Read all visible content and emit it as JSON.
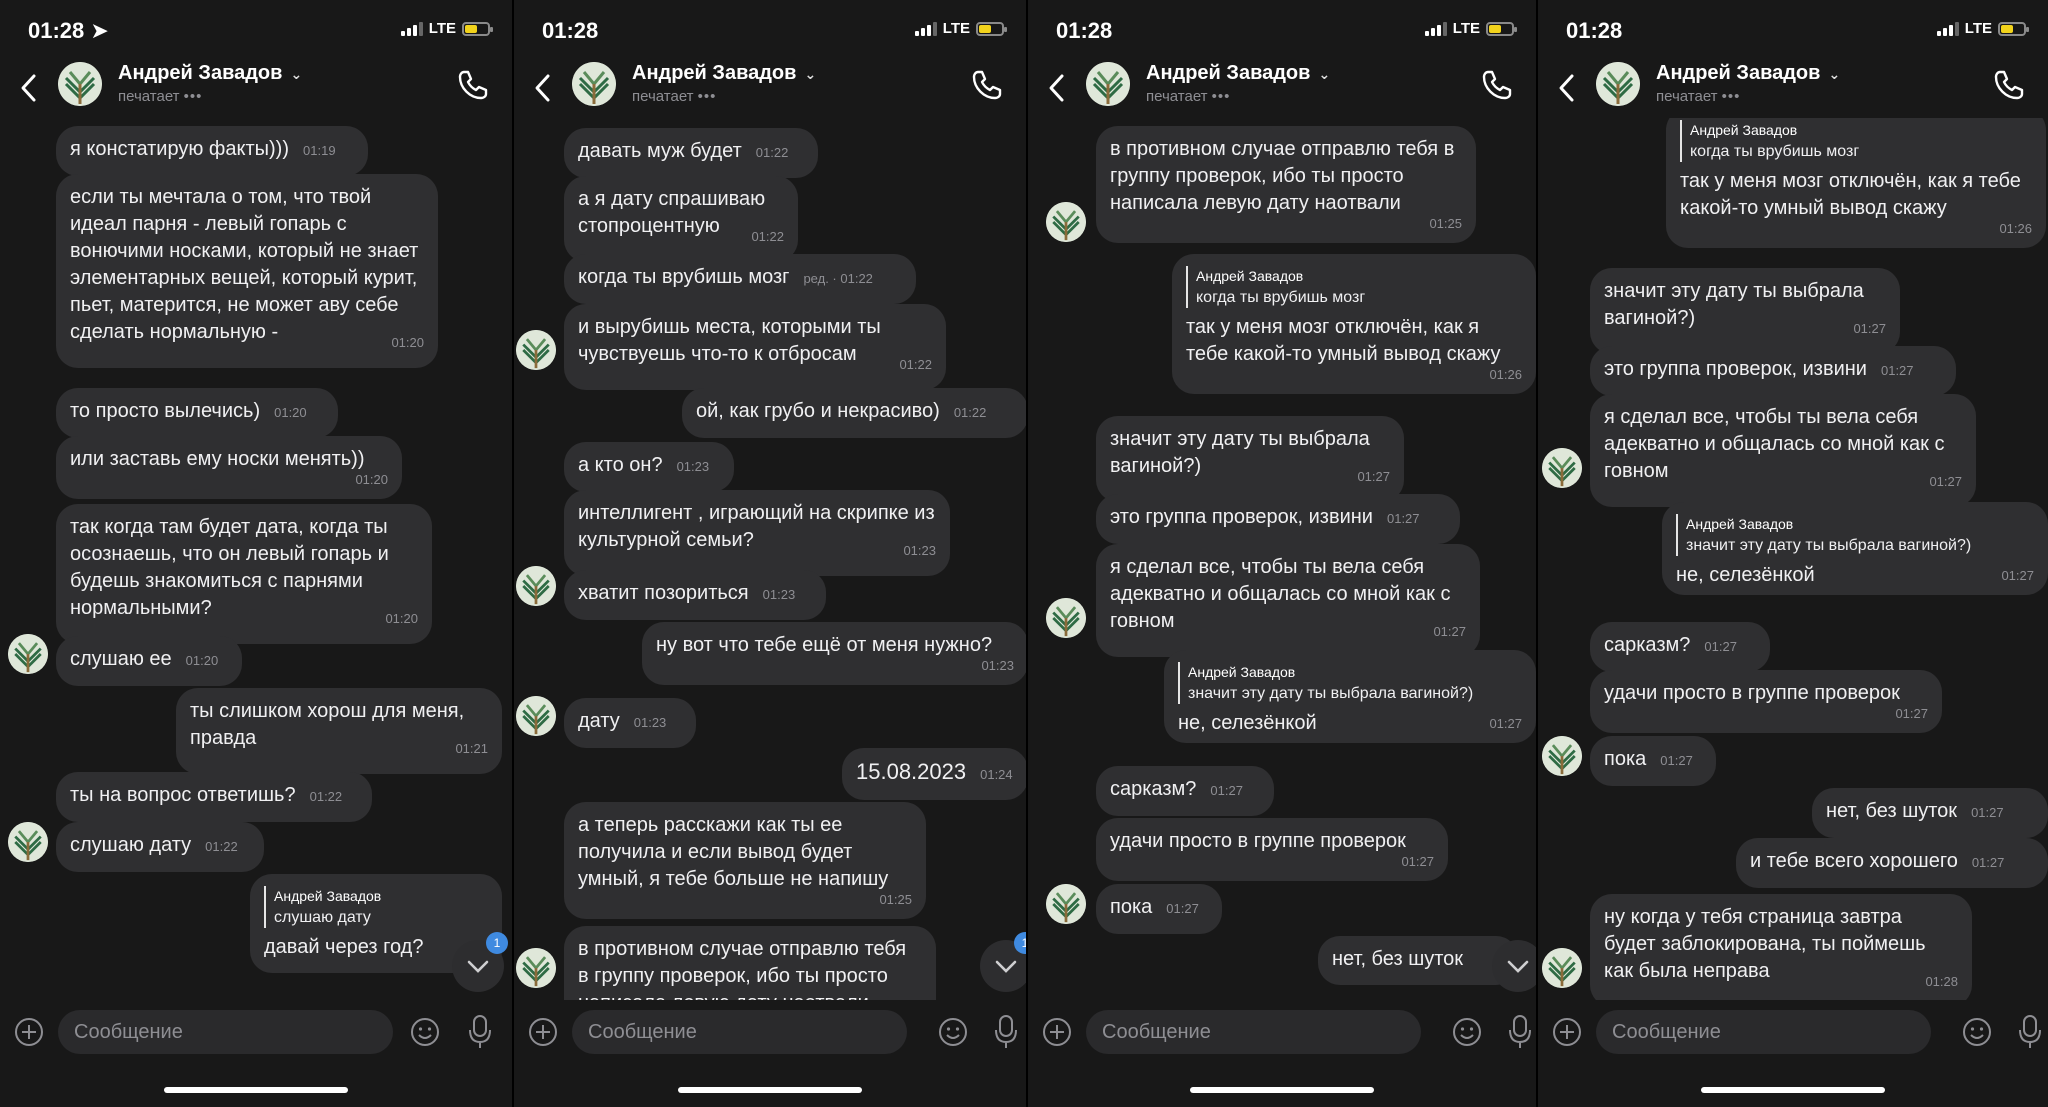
{
  "panels": [
    {
      "time": "01:28 ➤",
      "contact": "Андрей Завадов",
      "status": "печатает",
      "placeholder": "Сообщение",
      "messages": [
        {
          "text": "я констатирую факты)))",
          "time": "01:19"
        },
        {
          "text": "если ты мечтала о том, что твой идеал парня - левый гопарь с вонючими носками, который не знает элементарных вещей, который курит, пьет, матерится, не может аву себе сделать нормальную -",
          "time": "01:20"
        },
        {
          "text": "то просто вылечись)",
          "time": "01:20"
        },
        {
          "text": "или заставь ему носки менять))",
          "time": "01:20"
        },
        {
          "text": "так когда там будет дата, когда ты осознаешь, что он левый гопарь и будешь знакомиться с парнями нормальными?",
          "time": "01:20"
        },
        {
          "text": "слушаю ее",
          "time": "01:20"
        },
        {
          "text": "ты слишком хорош для меня, правда",
          "time": "01:21"
        },
        {
          "text": "ты на вопрос ответишь?",
          "time": "01:22"
        },
        {
          "text": "слушаю дату",
          "time": "01:22"
        },
        {
          "reply_name": "Андрей Завадов",
          "reply_text": "слушаю дату",
          "text": "давай через год?",
          "time": ""
        }
      ],
      "unread": "1"
    },
    {
      "time": "01:28",
      "contact": "Андрей Завадов",
      "status": "печатает",
      "placeholder": "Сообщение",
      "messages": [
        {
          "text": "давать муж будет",
          "time": "01:22"
        },
        {
          "text": "а я дату спрашиваю стопроцентную",
          "time": "01:22"
        },
        {
          "text": "когда ты врубишь мозг",
          "time": "ред. · 01:22"
        },
        {
          "text": "и вырубишь места, которыми ты чувствуешь что-то к отбросам",
          "time": "01:22"
        },
        {
          "text": "ой, как грубо и некрасиво)",
          "time": "01:22"
        },
        {
          "text": "а кто он?",
          "time": "01:23"
        },
        {
          "text": "интеллигент , играющий на скрипке из культурной семьи?",
          "time": "01:23"
        },
        {
          "text": "хватит позориться",
          "time": "01:23"
        },
        {
          "text": "ну вот что тебе ещё от меня нужно?",
          "time": "01:23"
        },
        {
          "text": "дату",
          "time": "01:23"
        },
        {
          "text": "15.08.2023",
          "time": "01:24"
        },
        {
          "text": "а теперь расскажи как ты ее получила и если вывод будет умный, я тебе больше не напишу",
          "time": "01:25"
        },
        {
          "text": "в противном случае отправлю тебя в группу проверок, ибо ты просто написала левую дату наотвали",
          "time": ""
        }
      ],
      "unread": "1"
    },
    {
      "time": "01:28",
      "contact": "Андрей Завадов",
      "status": "печатает",
      "placeholder": "Сообщение",
      "messages": [
        {
          "text": "в противном случае отправлю тебя в группу проверок, ибо ты просто написала левую дату наотвали",
          "time": "01:25"
        },
        {
          "reply_name": "Андрей Завадов",
          "reply_text": "когда ты врубишь мозг",
          "text": "так у меня мозг отключён, как я тебе какой-то умный вывод скажу",
          "time": "01:26"
        },
        {
          "text": "значит эту дату ты выбрала вагиной?)",
          "time": "01:27"
        },
        {
          "text": "это группа проверок, извини",
          "time": "01:27"
        },
        {
          "text": "я сделал все, чтобы ты вела себя адекватно и общалась со мной как с говном",
          "time": "01:27"
        },
        {
          "reply_name": "Андрей Завадов",
          "reply_text": "значит эту дату ты выбрала вагиной?)",
          "text": "не, селезёнкой",
          "time": "01:27"
        },
        {
          "text": "сарказм?",
          "time": "01:27"
        },
        {
          "text": "удачи просто в группе проверок",
          "time": "01:27"
        },
        {
          "text": "пока",
          "time": "01:27"
        },
        {
          "text": "нет, без шуток",
          "time": ""
        }
      ]
    },
    {
      "time": "01:28",
      "contact": "Андрей Завадов",
      "status": "печатает",
      "placeholder": "Сообщение",
      "messages": [
        {
          "reply_name": "Андрей Завадов",
          "reply_text": "когда ты врубишь мозг",
          "text": "так у меня мозг отключён, как я тебе какой-то умный вывод скажу",
          "time": "01:26"
        },
        {
          "text": "значит эту дату ты выбрала вагиной?)",
          "time": "01:27"
        },
        {
          "text": "это группа проверок, извини",
          "time": "01:27"
        },
        {
          "text": "я сделал все, чтобы ты вела себя адекватно и общалась со мной как с говном",
          "time": "01:27"
        },
        {
          "reply_name": "Андрей Завадов",
          "reply_text": "значит эту дату ты выбрала вагиной?)",
          "text": "не, селезёнкой",
          "time": "01:27"
        },
        {
          "text": "сарказм?",
          "time": "01:27"
        },
        {
          "text": "удачи просто в группе проверок",
          "time": "01:27"
        },
        {
          "text": "пока",
          "time": "01:27"
        },
        {
          "text": "нет, без шуток",
          "time": "01:27"
        },
        {
          "text": "и тебе всего хорошего",
          "time": "01:27"
        },
        {
          "text": "ну когда у тебя страница завтра будет заблокирована, ты поймешь как была неправа",
          "time": "01:28"
        }
      ]
    }
  ]
}
